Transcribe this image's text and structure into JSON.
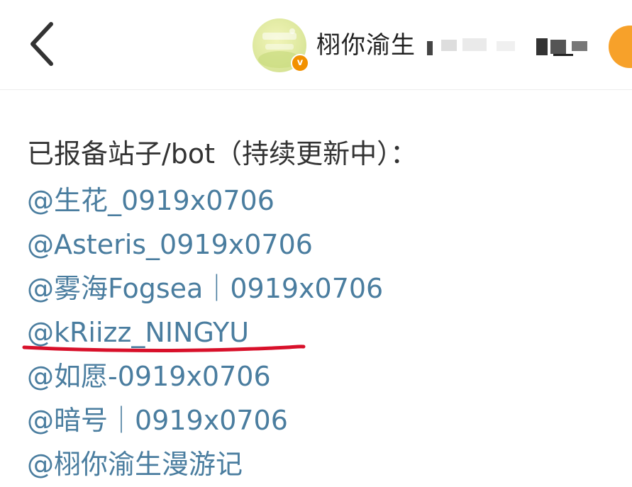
{
  "header": {
    "back_icon": "chevron-left-icon",
    "account_name": "栩你渝生",
    "verified_badge": "v",
    "avatar_text": "栩你渝生",
    "accent_color": "#f29100"
  },
  "post": {
    "intro": "已报备站子/bot（持续更新中）：",
    "mentions": [
      "@生花_0919x0706",
      "@Asteris_0919x0706",
      "@雾海Fogsea｜0919x0706",
      "@kRiizz_NINGYU",
      "@如愿-0919x0706",
      "@暗号｜0919x0706",
      "@栩你渝生漫游记"
    ],
    "mention_color": "#4a7d9f",
    "highlight_color": "#d8102a"
  }
}
